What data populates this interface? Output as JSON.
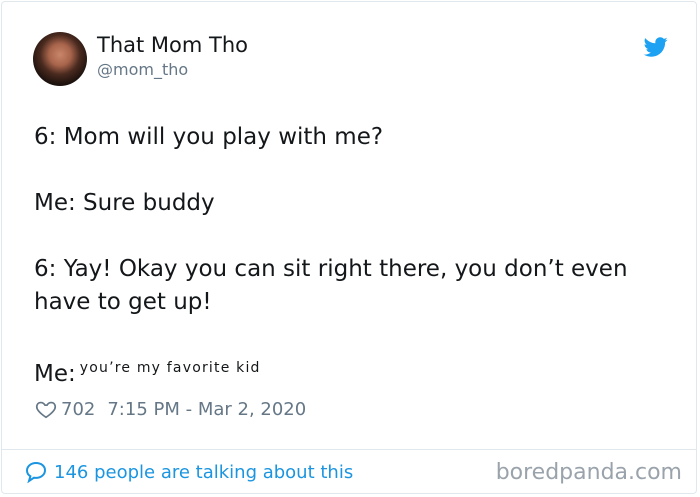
{
  "author": {
    "name": "That Mom Tho",
    "handle": "@mom_tho"
  },
  "tweet": {
    "lines": [
      "6: Mom will you play with me?",
      "Me: Sure buddy",
      "6: Yay! Okay you can sit right there, you don’t even have to get up!"
    ],
    "last_prefix": "Me:",
    "last_small_text": "you’re my favorite kid"
  },
  "meta": {
    "likes": "702",
    "timestamp": "7:15 PM - Mar 2, 2020"
  },
  "footer": {
    "talking": "146 people are talking about this",
    "watermark": "boredpanda.com"
  },
  "colors": {
    "twitter_blue": "#1da1f2",
    "link_blue": "#1b95e0",
    "muted_gray": "#657786"
  },
  "icons": [
    "twitter-bird-icon",
    "heart-icon",
    "speech-bubble-icon"
  ]
}
